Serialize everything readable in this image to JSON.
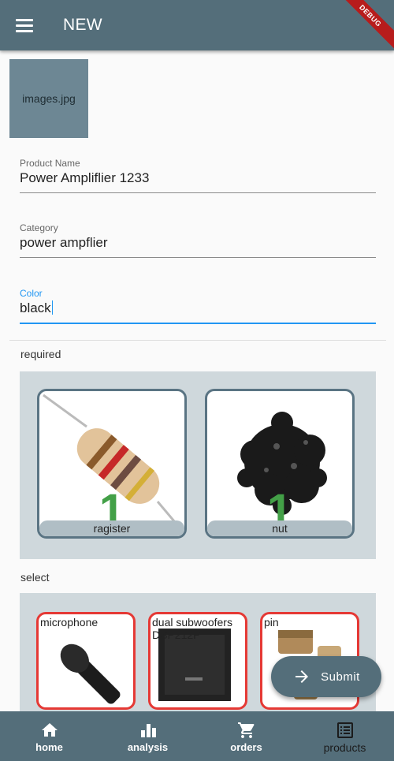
{
  "appbar": {
    "title": "NEW",
    "debug_label": "DEBUG"
  },
  "image": {
    "label": "images.jpg"
  },
  "form": {
    "product_name": {
      "label": "Product Name",
      "value": "Power Ampliflier 1233"
    },
    "category": {
      "label": "Category",
      "value": "power ampflier"
    },
    "color": {
      "label": "Color",
      "value": "black"
    }
  },
  "required": {
    "title": "required",
    "items": [
      {
        "label": "ragister",
        "count": "1"
      },
      {
        "label": "nut",
        "count": "1"
      }
    ]
  },
  "select": {
    "title": "select",
    "items": [
      {
        "label": "microphone"
      },
      {
        "label": "dual subwoofers DSP212P"
      },
      {
        "label": "pin"
      }
    ]
  },
  "fab": {
    "label": "Submit"
  },
  "nav": {
    "items": [
      {
        "label": "home",
        "icon": "home-icon"
      },
      {
        "label": "analysis",
        "icon": "bar-chart-icon"
      },
      {
        "label": "orders",
        "icon": "cart-icon"
      },
      {
        "label": "products",
        "icon": "list-icon"
      }
    ]
  },
  "colors": {
    "primary": "#546e7a",
    "accent": "#2196f3",
    "count": "#43a047",
    "select_border": "#e53935"
  }
}
